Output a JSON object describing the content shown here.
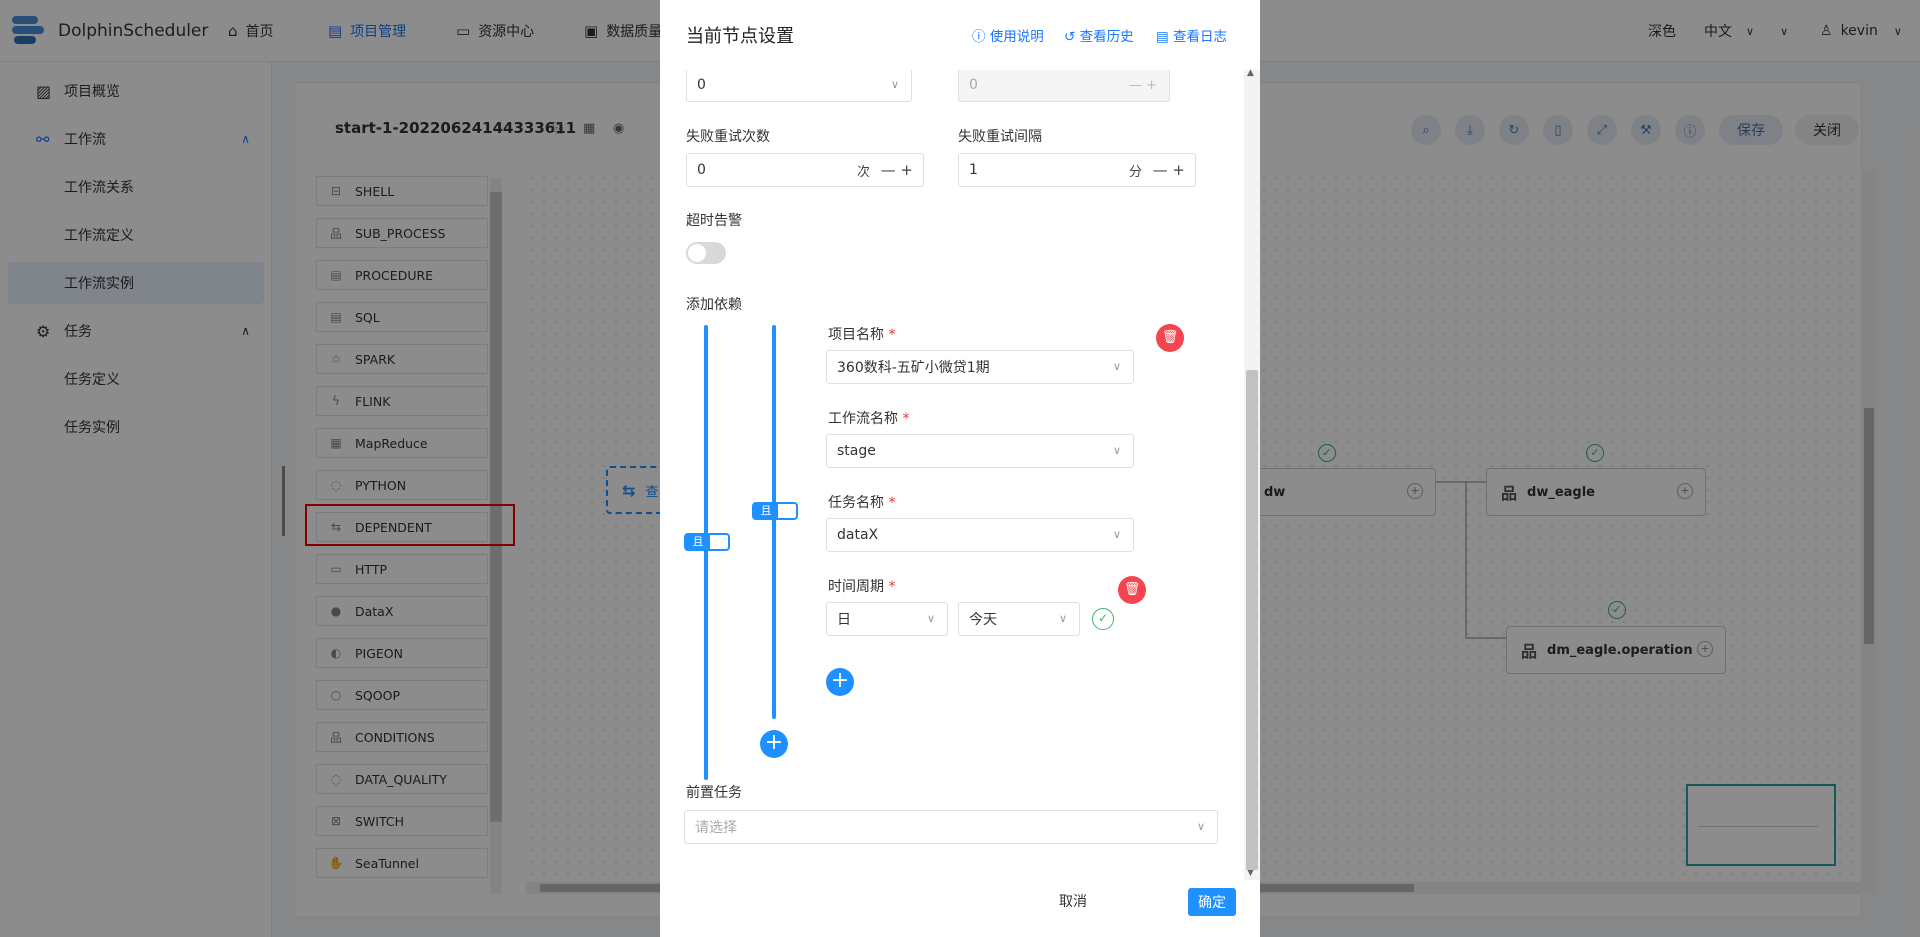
{
  "app": {
    "name": "DolphinScheduler"
  },
  "nav": [
    {
      "label": "首页",
      "icon": "home-icon"
    },
    {
      "label": "项目管理",
      "icon": "project-icon"
    },
    {
      "label": "资源中心",
      "icon": "folder-icon"
    },
    {
      "label": "数据质量",
      "icon": "data-quality-icon"
    }
  ],
  "topright": {
    "theme": "深色",
    "lang": "中文",
    "user": "kevin"
  },
  "sidebar": {
    "overview": "项目概览",
    "workflow": "工作流",
    "wf_relation": "工作流关系",
    "wf_definition": "工作流定义",
    "wf_instance": "工作流实例",
    "task": "任务",
    "task_definition": "任务定义",
    "task_instance": "任务实例"
  },
  "workflow": {
    "title": "start-1-20220624144333611",
    "save": "保存",
    "close": "关闭"
  },
  "palette": [
    "SHELL",
    "SUB_PROCESS",
    "PROCEDURE",
    "SQL",
    "SPARK",
    "FLINK",
    "MapReduce",
    "PYTHON",
    "DEPENDENT",
    "HTTP",
    "DataX",
    "PIGEON",
    "SQOOP",
    "CONDITIONS",
    "DATA_QUALITY",
    "SWITCH",
    "SeaTunnel"
  ],
  "canvas": {
    "nodes": {
      "dw": "dw",
      "dw_eagle": "dw_eagle",
      "dm": "dm_eagle.operation",
      "partial": "查"
    }
  },
  "modal": {
    "title": "当前节点设置",
    "links": {
      "help": "使用说明",
      "history": "查看历史",
      "log": "查看日志"
    },
    "top_values": {
      "a": "0",
      "b": "0"
    },
    "retry_times_label": "失败重试次数",
    "retry_times_value": "0",
    "retry_times_unit": "次",
    "retry_interval_label": "失败重试间隔",
    "retry_interval_value": "1",
    "retry_interval_unit": "分",
    "timeout_label": "超时告警",
    "timeout_enabled": false,
    "add_dependency_label": "添加依赖",
    "relation_outer": "且",
    "relation_inner": "且",
    "project_label": "项目名称",
    "project_value": "360数科-五矿小微贷1期",
    "workflow_label": "工作流名称",
    "workflow_value": "stage",
    "task_label": "任务名称",
    "task_value": "dataX",
    "cycle_label": "时间周期",
    "cycle_value": "日",
    "date_value": "今天",
    "pre_task_label": "前置任务",
    "pre_task_placeholder": "请选择",
    "cancel": "取消",
    "confirm": "确定"
  }
}
